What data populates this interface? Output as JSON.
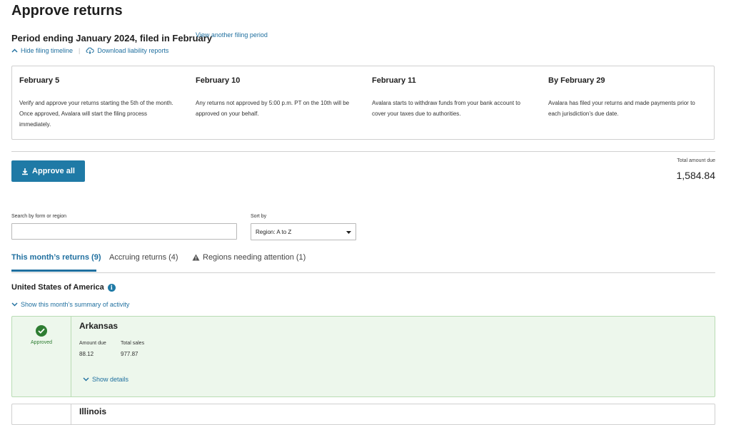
{
  "page": {
    "title": "Approve returns"
  },
  "period": {
    "title": "Period ending January 2024, filed in February",
    "view_another_label": "View another filing period",
    "hide_timeline_label": "Hide filing timeline",
    "download_reports_label": "Download liability reports"
  },
  "timeline": [
    {
      "date": "February 5",
      "description": "Verify and approve your returns starting the 5th of the month. Once approved, Avalara will start the filing process immediately."
    },
    {
      "date": "February 10",
      "description": "Any returns not approved by 5:00 p.m. PT on the 10th will be approved on your behalf."
    },
    {
      "date": "February 11",
      "description": "Avalara starts to withdraw funds from your bank account to cover your taxes due to authorities."
    },
    {
      "date": "By February 29",
      "description": "Avalara has filed your returns and made payments prior to each jurisdiction’s due date."
    }
  ],
  "actions": {
    "approve_all_label": "Approve all"
  },
  "total": {
    "label": "Total amount due",
    "value": "1,584.84"
  },
  "filters": {
    "search_label": "Search by form or region",
    "search_value": "",
    "sort_label": "Sort by",
    "sort_value": "Region: A to Z"
  },
  "tabs": [
    {
      "label": "This month’s returns (9)",
      "active": true
    },
    {
      "label": "Accruing returns (4)",
      "active": false
    },
    {
      "label": "Regions needing attention (1)",
      "active": false
    }
  ],
  "country": {
    "name": "United States of America",
    "show_summary_label": "Show this month’s summary of activity"
  },
  "regions": [
    {
      "name": "Arkansas",
      "status": "Approved",
      "amount_due_label": "Amount due",
      "amount_due": "88.12",
      "total_sales_label": "Total sales",
      "total_sales": "977.87",
      "show_details_label": "Show details"
    },
    {
      "name": "Illinois"
    }
  ],
  "colors": {
    "accent": "#1f7aa6",
    "link": "#1f6f9f",
    "approved": "#2e7d32",
    "approved_bg": "#edf7ec"
  }
}
